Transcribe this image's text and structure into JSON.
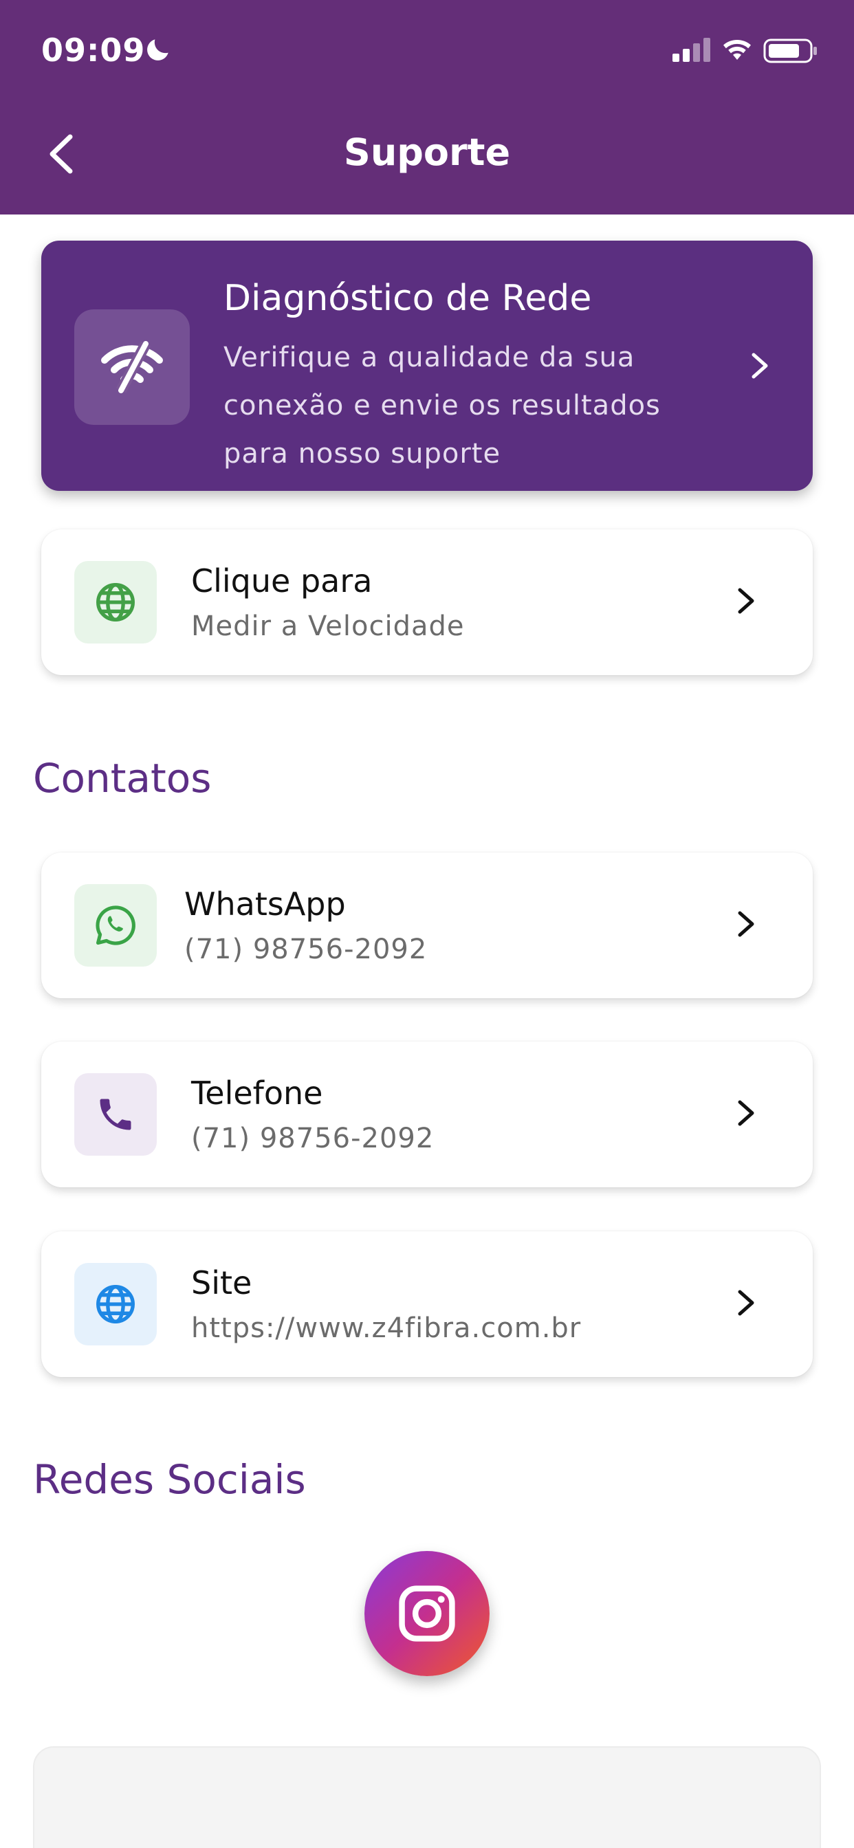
{
  "status_bar": {
    "time": "09:09"
  },
  "header": {
    "title": "Suporte"
  },
  "diagnostic": {
    "title": "Diagnóstico de Rede",
    "description": "Verifique a qualidade da sua conexão e envie os resultados para nosso suporte"
  },
  "speed_test": {
    "title": "Clique para",
    "subtitle": "Medir a Velocidade"
  },
  "contacts": {
    "section_title": "Contatos",
    "items": [
      {
        "title": "WhatsApp",
        "subtitle": "(71) 98756-2092",
        "icon": "whatsapp-icon",
        "icon_color": "#3aa447",
        "icon_bg": "#e8f5e9"
      },
      {
        "title": "Telefone",
        "subtitle": "(71) 98756-2092",
        "icon": "phone-icon",
        "icon_color": "#5c2e85",
        "icon_bg": "#efe9f4"
      },
      {
        "title": "Site",
        "subtitle": "https://www.z4fibra.com.br",
        "icon": "globe-icon",
        "icon_color": "#1e88e5",
        "icon_bg": "#e5f1fc"
      }
    ]
  },
  "social": {
    "section_title": "Redes Sociais",
    "icon": "instagram-icon"
  },
  "colors": {
    "header": "#642e78",
    "diagnostic_card": "#5b2f80",
    "section_title": "#5c2e85",
    "speed_icon": "#43a047"
  }
}
